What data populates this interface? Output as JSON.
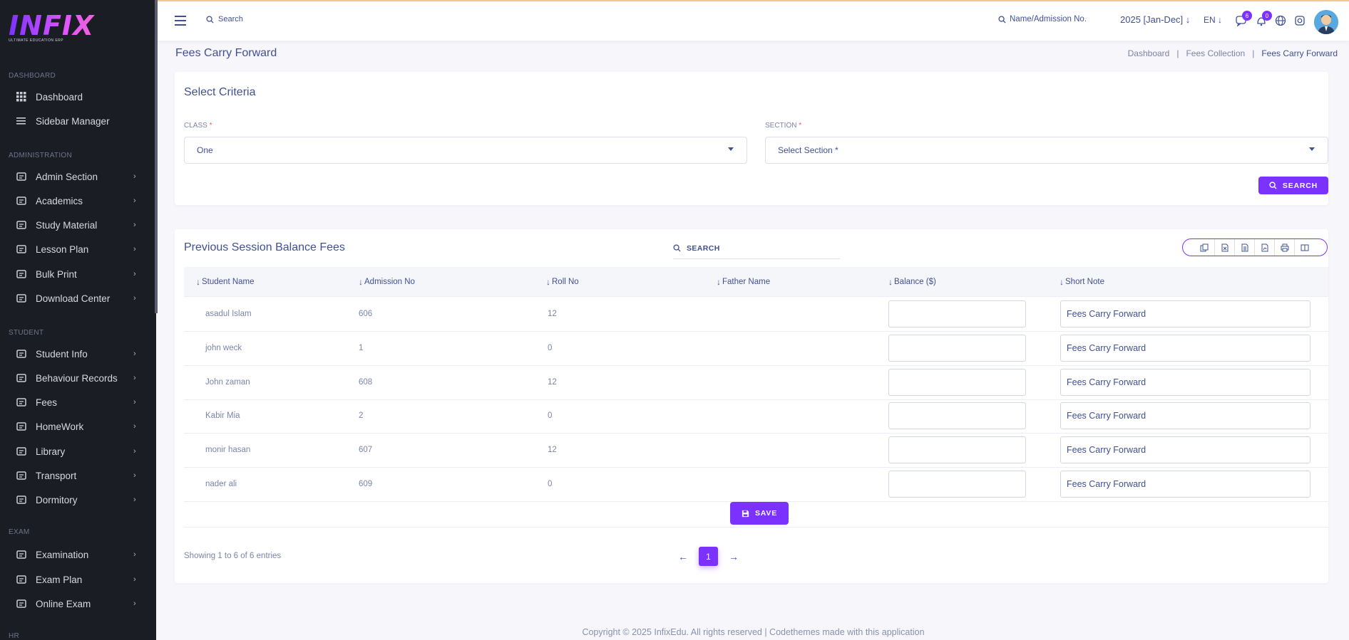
{
  "brand": {
    "logo_text": "INFIX",
    "logo_sub": "ULTIMATE EDUCATION ERP"
  },
  "sidebar": {
    "sections": [
      {
        "heading": "DASHBOARD",
        "items": [
          {
            "label": "Dashboard",
            "icon": "grid-icon",
            "chevron": false
          },
          {
            "label": "Sidebar Manager",
            "icon": "bars-icon",
            "chevron": false
          }
        ]
      },
      {
        "heading": "ADMINISTRATION",
        "items": [
          {
            "label": "Admin Section",
            "icon": "admin-icon",
            "chevron": true
          },
          {
            "label": "Academics",
            "icon": "graduation-cap-icon",
            "chevron": true
          },
          {
            "label": "Study Material",
            "icon": "download-icon",
            "chevron": true
          },
          {
            "label": "Lesson Plan",
            "icon": "list-icon",
            "chevron": true
          },
          {
            "label": "Bulk Print",
            "icon": "print-icon",
            "chevron": true
          },
          {
            "label": "Download Center",
            "icon": "download-icon",
            "chevron": true
          }
        ]
      },
      {
        "heading": "STUDENT",
        "items": [
          {
            "label": "Student Info",
            "icon": "user-icon",
            "chevron": true
          },
          {
            "label": "Behaviour Records",
            "icon": "records-icon",
            "chevron": true
          },
          {
            "label": "Fees",
            "icon": "money-icon",
            "chevron": true
          },
          {
            "label": "HomeWork",
            "icon": "book-icon",
            "chevron": true
          },
          {
            "label": "Library",
            "icon": "library-icon",
            "chevron": true
          },
          {
            "label": "Transport",
            "icon": "bus-icon",
            "chevron": true
          },
          {
            "label": "Dormitory",
            "icon": "bed-icon",
            "chevron": true
          }
        ]
      },
      {
        "heading": "EXAM",
        "items": [
          {
            "label": "Examination",
            "icon": "map-icon",
            "chevron": true
          },
          {
            "label": "Exam Plan",
            "icon": "clipboard-icon",
            "chevron": true
          },
          {
            "label": "Online Exam",
            "icon": "globe-icon",
            "chevron": true
          }
        ]
      },
      {
        "heading": "HR",
        "items": []
      }
    ]
  },
  "topbar": {
    "search_label": "Search",
    "name_admission_label": "Name/Admission No.",
    "session": "2025 [Jan-Dec]",
    "language": "EN",
    "chat_count": "6",
    "notification_count": "0"
  },
  "page": {
    "title": "Fees Carry Forward",
    "breadcrumb": [
      "Dashboard",
      "Fees Collection",
      "Fees Carry Forward"
    ]
  },
  "criteria": {
    "title": "Select Criteria",
    "class_label": "CLASS",
    "class_value": "One",
    "section_label": "SECTION",
    "section_placeholder": "Select Section *",
    "required_mark": "*",
    "search_button": "SEARCH"
  },
  "table": {
    "title": "Previous Session Balance Fees",
    "search_label": "SEARCH",
    "columns": [
      "Student Name",
      "Admission No",
      "Roll No",
      "Father Name",
      "Balance ($)",
      "Short Note"
    ],
    "rows": [
      {
        "name": "asadul Islam",
        "admission": "606",
        "roll": "12",
        "father": "",
        "balance": "",
        "note": "Fees Carry Forward"
      },
      {
        "name": "john weck",
        "admission": "1",
        "roll": "0",
        "father": "",
        "balance": "",
        "note": "Fees Carry Forward"
      },
      {
        "name": "John zaman",
        "admission": "608",
        "roll": "12",
        "father": "",
        "balance": "",
        "note": "Fees Carry Forward"
      },
      {
        "name": "Kabir Mia",
        "admission": "2",
        "roll": "0",
        "father": "",
        "balance": "",
        "note": "Fees Carry Forward"
      },
      {
        "name": "monir hasan",
        "admission": "607",
        "roll": "12",
        "father": "",
        "balance": "",
        "note": "Fees Carry Forward"
      },
      {
        "name": "nader ali",
        "admission": "609",
        "roll": "0",
        "father": "",
        "balance": "",
        "note": "Fees Carry Forward"
      }
    ],
    "save_button": "SAVE",
    "showing_text": "Showing 1 to 6 of 6 entries",
    "current_page": "1",
    "export_buttons": [
      "copy-icon",
      "excel-icon",
      "csv-icon",
      "pdf-icon",
      "print-icon",
      "columns-icon"
    ]
  },
  "footer": {
    "text": "Copyright © 2025 InfixEdu. All rights reserved | Codethemes made with this application"
  },
  "colors": {
    "accent": "#7c32ff",
    "text": "#415094",
    "sidebar_bg": "#1b1d25"
  }
}
